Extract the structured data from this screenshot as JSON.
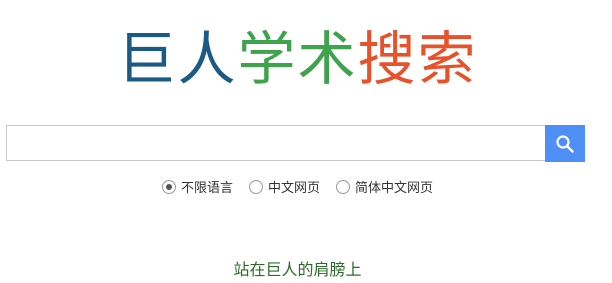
{
  "logo": {
    "chars": [
      {
        "text": "巨",
        "color": "#1c5a86"
      },
      {
        "text": "人",
        "color": "#1c5a86"
      },
      {
        "text": "学",
        "color": "#3fa34d"
      },
      {
        "text": "术",
        "color": "#3fa34d"
      },
      {
        "text": "搜",
        "color": "#e8522b"
      },
      {
        "text": "索",
        "color": "#e8522b"
      }
    ]
  },
  "search": {
    "value": "",
    "placeholder": "",
    "button_icon": "search-icon",
    "button_color": "#4e8ef7"
  },
  "language_options": [
    {
      "label": "不限语言",
      "selected": true
    },
    {
      "label": "中文网页",
      "selected": false
    },
    {
      "label": "简体中文网页",
      "selected": false
    }
  ],
  "slogan": "站在巨人的肩膀上"
}
